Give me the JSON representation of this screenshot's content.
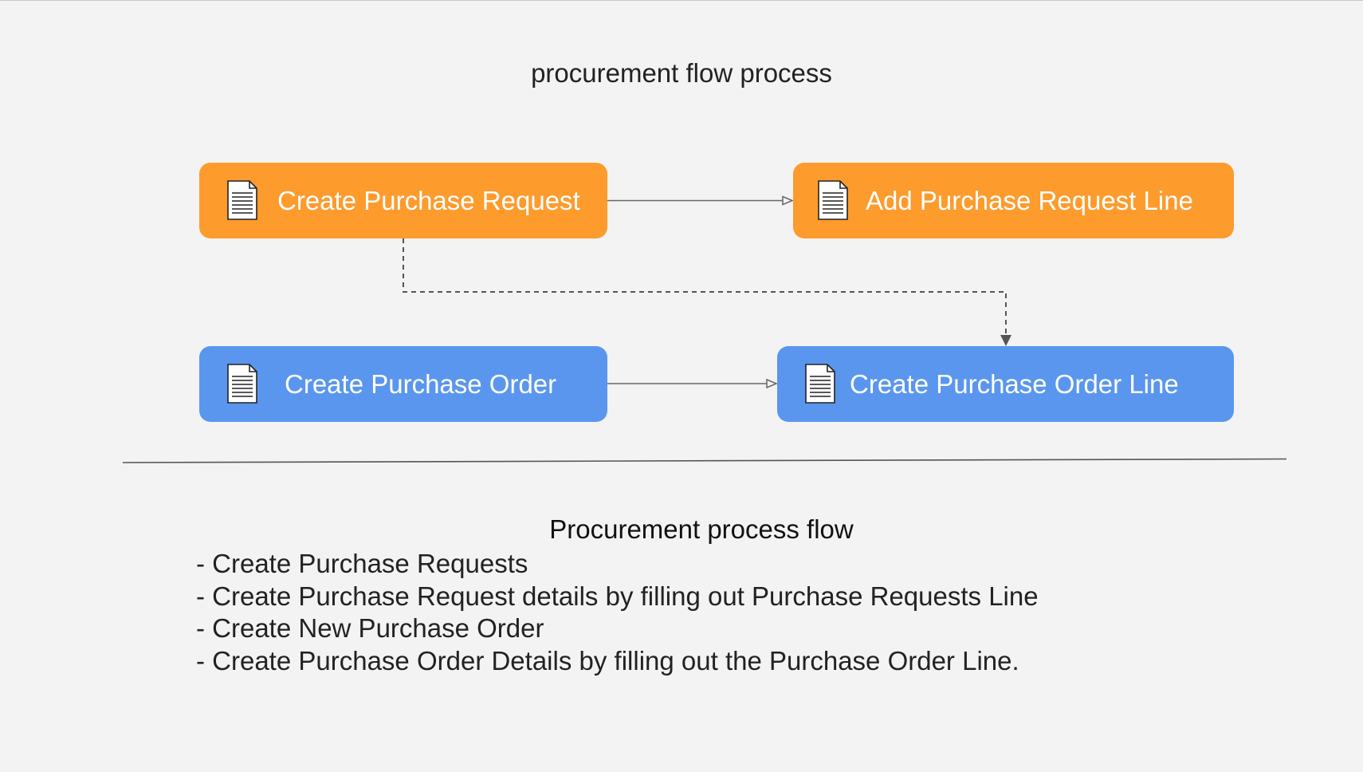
{
  "diagram": {
    "title": "procurement flow process",
    "colors": {
      "request_node": "#fd9b2d",
      "order_node": "#5a96ee",
      "connector": "#666666",
      "background": "#f3f3f3"
    },
    "nodes": [
      {
        "id": "create-purchase-request",
        "label": "Create Purchase Request",
        "icon": "document-icon"
      },
      {
        "id": "add-purchase-request-line",
        "label": "Add Purchase Request Line",
        "icon": "document-icon"
      },
      {
        "id": "create-purchase-order",
        "label": "Create Purchase Order",
        "icon": "document-icon"
      },
      {
        "id": "create-purchase-order-line",
        "label": "Create Purchase Order Line",
        "icon": "document-icon"
      }
    ],
    "edges": [
      {
        "from": "create-purchase-request",
        "to": "add-purchase-request-line",
        "style": "solid",
        "arrow": "open-triangle"
      },
      {
        "from": "create-purchase-request",
        "to": "create-purchase-order-line",
        "style": "dashed",
        "arrow": "filled-triangle"
      },
      {
        "from": "create-purchase-order",
        "to": "create-purchase-order-line",
        "style": "solid",
        "arrow": "open-triangle"
      }
    ]
  },
  "notes": {
    "heading": "Procurement process flow",
    "items": [
      "- Create Purchase Requests",
      "- Create Purchase Request details by filling out Purchase Requests Line",
      "- Create New Purchase Order",
      "- Create Purchase Order Details by filling out the Purchase Order Line."
    ]
  }
}
